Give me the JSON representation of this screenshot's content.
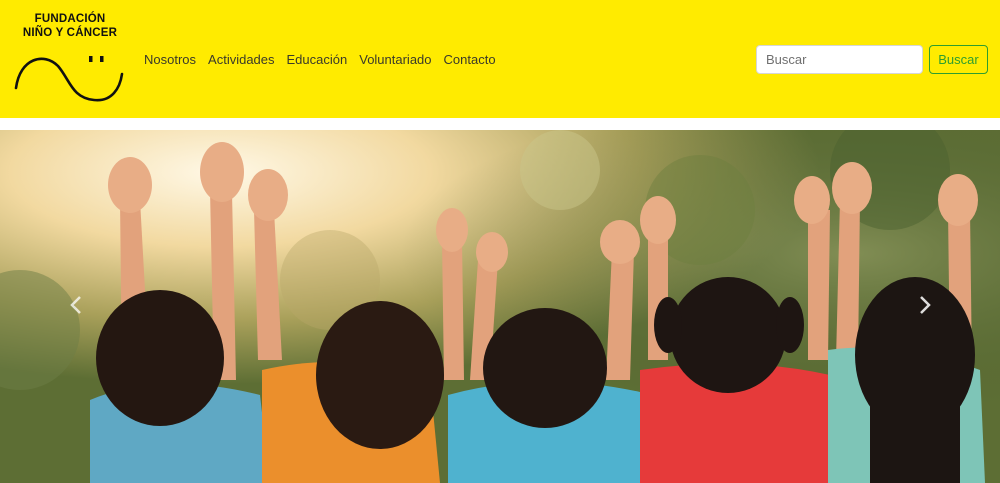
{
  "brand": {
    "line1": "FUNDACIÓN",
    "line2": "NIÑO Y CÁNCER"
  },
  "nav": {
    "items": [
      {
        "label": "Nosotros"
      },
      {
        "label": "Actividades"
      },
      {
        "label": "Educación"
      },
      {
        "label": "Voluntariado"
      },
      {
        "label": "Contacto"
      }
    ]
  },
  "search": {
    "placeholder": "Buscar",
    "button_label": "Buscar"
  },
  "carousel": {
    "prev_icon": "chevron-left-icon",
    "next_icon": "chevron-right-icon"
  },
  "colors": {
    "navbar_bg": "#ffeb00",
    "search_button": "#2e9e2e"
  }
}
